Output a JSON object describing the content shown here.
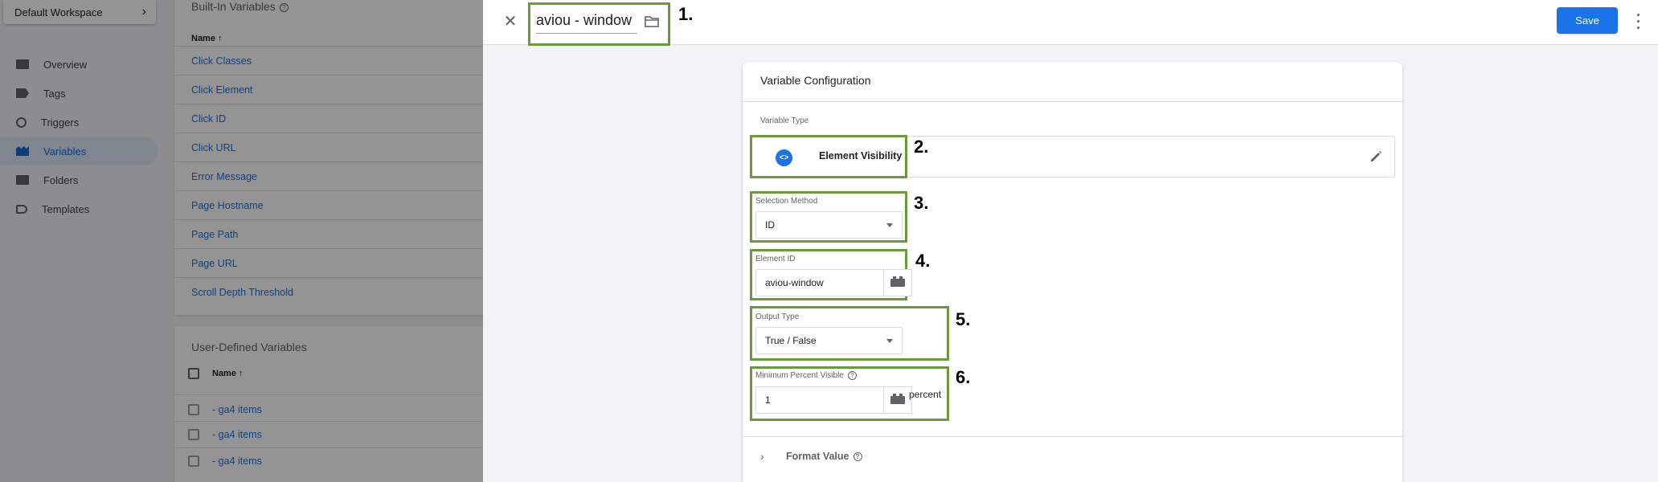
{
  "workspace": {
    "label": "Default Workspace"
  },
  "nav": [
    {
      "label": "Overview",
      "icon": "folder-icon"
    },
    {
      "label": "Tags",
      "icon": "tag-icon"
    },
    {
      "label": "Triggers",
      "icon": "trigger-icon"
    },
    {
      "label": "Variables",
      "icon": "variable-icon",
      "active": true
    },
    {
      "label": "Folders",
      "icon": "folder-icon"
    },
    {
      "label": "Templates",
      "icon": "template-icon"
    }
  ],
  "builtin": {
    "title": "Built-In Variables",
    "column": "Name ↑",
    "rows": [
      "Click Classes",
      "Click Element",
      "Click ID",
      "Click URL",
      "Error Message",
      "Page Hostname",
      "Page Path",
      "Page URL",
      "Scroll Depth Threshold"
    ]
  },
  "userdefined": {
    "title": "User-Defined Variables",
    "column": "Name ↑",
    "rows": [
      "- ga4 items",
      "- ga4 items",
      "- ga4 items"
    ]
  },
  "editor": {
    "name": "aviou - window",
    "save_label": "Save",
    "config_title": "Variable Configuration",
    "variable_type_label": "Variable Type",
    "variable_type": "Element Visibility",
    "selection_method_label": "Selection Method",
    "selection_method": "ID",
    "element_id_label": "Element ID",
    "element_id": "aviou-window",
    "output_type_label": "Output Type",
    "output_type": "True / False",
    "min_percent_label": "Minimum Percent Visible",
    "min_percent": "1",
    "percent_suffix": "percent",
    "format_value_label": "Format Value"
  },
  "annotations": [
    "1.",
    "2.",
    "3.",
    "4.",
    "5.",
    "6."
  ],
  "colors": {
    "accent": "#1a73e8",
    "highlight": "#6a9a3a"
  }
}
